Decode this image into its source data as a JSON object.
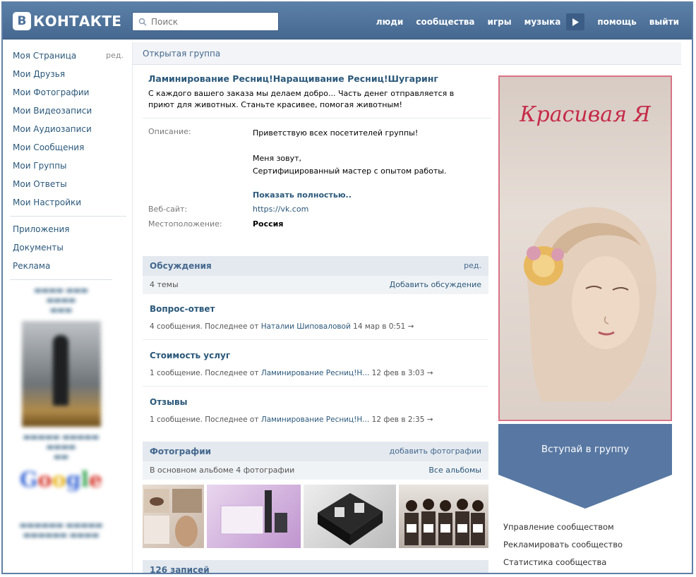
{
  "header": {
    "logo_mark": "В",
    "logo_text": "КОНТАКТЕ",
    "search_placeholder": "Поиск",
    "nav": [
      "люди",
      "сообщества",
      "игры",
      "музыка",
      "помощь",
      "выйти"
    ]
  },
  "sidebar": {
    "items": [
      {
        "label": "Моя Страница",
        "extra": "ред."
      },
      {
        "label": "Мои Друзья"
      },
      {
        "label": "Мои Фотографии"
      },
      {
        "label": "Мои Видеозаписи"
      },
      {
        "label": "Мои Аудиозаписи"
      },
      {
        "label": "Мои Сообщения"
      },
      {
        "label": "Мои Группы"
      },
      {
        "label": "Мои Ответы"
      },
      {
        "label": "Мои Настройки"
      }
    ],
    "items2": [
      {
        "label": "Приложения"
      },
      {
        "label": "Документы"
      },
      {
        "label": "Реклама"
      }
    ]
  },
  "breadcrumb": "Открытая группа",
  "group": {
    "name": "Ламинирование Ресниц!Наращивание Ресниц!Шугаринг",
    "status": "С каждого вашего заказа мы делаем добро... Часть денег отправляется в приют для животных. Станьте красивее, помогая животным!",
    "description_label": "Описание:",
    "description_lines": [
      "Приветствую всех посетителей группы!",
      "Меня зовут,",
      "Сертифицированный мастер с опытом работы."
    ],
    "show_more": "Показать полностью..",
    "website_label": "Веб-сайт:",
    "website": "https://vk.com",
    "location_label": "Местоположение:",
    "location": "Россия"
  },
  "discussions": {
    "title": "Обсуждения",
    "edit": "ред.",
    "count": "4 темы",
    "add": "Добавить обсуждение",
    "topics": [
      {
        "title": "Вопрос-ответ",
        "meta": "4 сообщения. Последнее от",
        "author": "Наталии Шиповаловой",
        "date": "14 мар в 0:51"
      },
      {
        "title": "Стоимость услуг",
        "meta": "1 сообщение. Последнее от",
        "author": "Ламинирование Ресниц!Н...",
        "date": "12 фев в 3:03"
      },
      {
        "title": "Отзывы",
        "meta": "1 сообщение. Последнее от",
        "author": "Ламинирование Ресниц!Н...",
        "date": "12 фев в 2:35"
      }
    ]
  },
  "photos": {
    "title": "Фотографии",
    "add": "добавить фотографии",
    "album_info": "В основном альбоме 4 фотографии",
    "all": "Все альбомы"
  },
  "wall": {
    "count": "126 записей"
  },
  "banner": {
    "title": "Красивая Я"
  },
  "join_button": "Вступай в группу",
  "management": [
    "Управление сообществом",
    "Рекламировать сообщество",
    "Статистика сообщества"
  ],
  "colors": {
    "header": "#4e729a",
    "link": "#2b587a",
    "accent_border": "#d87486"
  }
}
